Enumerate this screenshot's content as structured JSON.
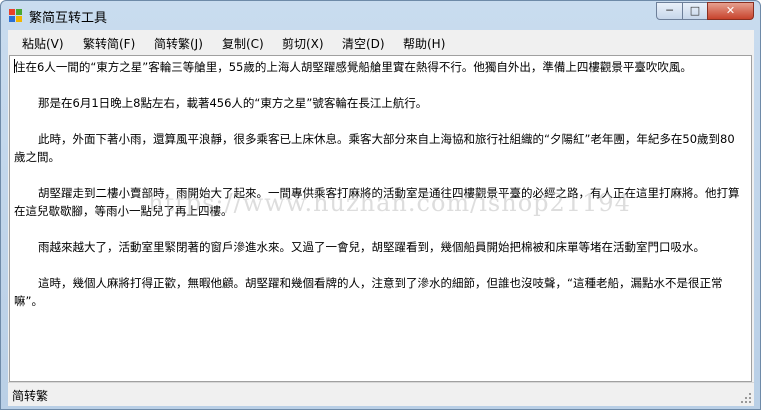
{
  "window": {
    "title": "繁简互转工具",
    "controls": {
      "minimize": "─",
      "maximize": "□",
      "close": "✕"
    }
  },
  "menu": [
    "粘贴(V)",
    "繁转简(F)",
    "简转繁(J)",
    "复制(C)",
    "剪切(X)",
    "清空(D)",
    "帮助(H)"
  ],
  "editor": {
    "paragraphs": [
      "住在6人一間的“東方之星”客輪三等艙里，55歲的上海人胡堅躍感覺船艙里實在熱得不行。他獨自外出，準備上四樓觀景平臺吹吹風。",
      "那是在6月1日晚上8點左右，載著456人的“東方之星”號客輪在長江上航行。",
      "此時，外面下著小雨，還算風平浪靜，很多乘客已上床休息。乘客大部分來自上海協和旅行社組織的“夕陽紅”老年團，年紀多在50歲到80歲之間。",
      "胡堅躍走到二樓小賣部時，雨開始大了起來。一間專供乘客打麻將的活動室是通往四樓觀景平臺的必經之路，有人正在這里打麻將。他打算在這兒歇歇腳，等雨小一點兒了再上四樓。",
      "雨越來越大了，活動室里緊閉著的窗戶滲進水來。又過了一會兒，胡堅躍看到，幾個船員開始把棉被和床單等堵在活動室門口吸水。",
      "這時，幾個人麻將打得正歡，無暇他顧。胡堅躍和幾個看牌的人，注意到了滲水的細節，但誰也沒吱聲，“這種老船，漏點水不是很正常嘛”。"
    ]
  },
  "watermark": "https://www.huzhan.com/ishop21194",
  "status": {
    "text": "简转繁"
  },
  "colors": {
    "window_frame": "#b9cfe6",
    "close_button": "#c7432c"
  }
}
